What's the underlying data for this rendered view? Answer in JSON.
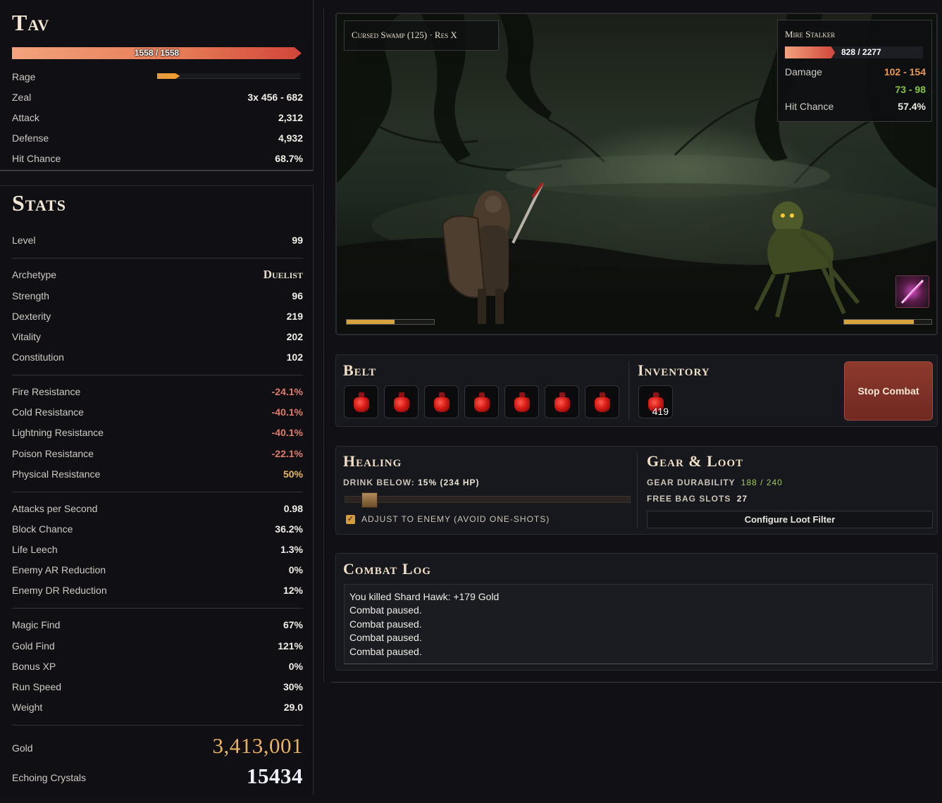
{
  "hero": {
    "name": "Tav",
    "hp_text": "1558 / 1558",
    "hp_fraction": 1.0,
    "rage_label": "Rage",
    "rage_fraction": 0.16,
    "rows": [
      {
        "label": "Zeal",
        "value": "3x 456 - 682"
      },
      {
        "label": "Attack",
        "value": "2,312"
      },
      {
        "label": "Defense",
        "value": "4,932"
      },
      {
        "label": "Hit Chance",
        "value": "68.7%"
      }
    ]
  },
  "stats": {
    "title": "Stats",
    "level": {
      "label": "Level",
      "value": "99"
    },
    "archetype": {
      "label": "Archetype",
      "value": "Duelist"
    },
    "attributes": [
      {
        "label": "Strength",
        "value": "96"
      },
      {
        "label": "Dexterity",
        "value": "219"
      },
      {
        "label": "Vitality",
        "value": "202"
      },
      {
        "label": "Constitution",
        "value": "102"
      }
    ],
    "resistances": [
      {
        "label": "Fire Resistance",
        "value": "-24.1%"
      },
      {
        "label": "Cold Resistance",
        "value": "-40.1%"
      },
      {
        "label": "Lightning Resistance",
        "value": "-40.1%"
      },
      {
        "label": "Poison Resistance",
        "value": "-22.1%"
      },
      {
        "label": "Physical Resistance",
        "value": "50%"
      }
    ],
    "combat": [
      {
        "label": "Attacks per Second",
        "value": "0.98"
      },
      {
        "label": "Block Chance",
        "value": "36.2%"
      },
      {
        "label": "Life Leech",
        "value": "1.3%"
      },
      {
        "label": "Enemy AR Reduction",
        "value": "0%"
      },
      {
        "label": "Enemy DR Reduction",
        "value": "12%"
      }
    ],
    "misc": [
      {
        "label": "Magic Find",
        "value": "67%"
      },
      {
        "label": "Gold Find",
        "value": "121%"
      },
      {
        "label": "Bonus XP",
        "value": "0%"
      },
      {
        "label": "Run Speed",
        "value": "30%"
      },
      {
        "label": "Weight",
        "value": "29.0"
      }
    ],
    "gold": {
      "label": "Gold",
      "value": "3,413,001"
    },
    "crystals": {
      "label": "Echoing Crystals",
      "value": "15434"
    }
  },
  "scene": {
    "zone": "Cursed Swamp (125) · Res X",
    "player_bar_fraction": 0.55,
    "enemy_bar_fraction": 0.8,
    "skill_icon": "arcane-slash-icon"
  },
  "enemy": {
    "name": "Mire Stalker",
    "hp_text": "828 / 2277",
    "hp_fraction": 0.364,
    "damage_label": "Damage",
    "damage_physical": "102 - 154",
    "damage_poison": "73 - 98",
    "hit_label": "Hit Chance",
    "hit_value": "57.4%"
  },
  "belt": {
    "title": "Belt",
    "slots": [
      "red-potion-icon",
      "red-potion-icon",
      "red-potion-icon",
      "red-potion-icon",
      "red-potion-icon",
      "red-potion-icon",
      "red-potion-icon"
    ]
  },
  "inventory": {
    "title": "Inventory",
    "item_icon": "red-potion-icon",
    "count": "419"
  },
  "stop_button": "Stop Combat",
  "healing": {
    "title": "Healing",
    "drink_label": "Drink below:",
    "drink_value": "15% (234 HP)",
    "threshold_fraction": 0.15,
    "adjust_label": "Adjust to enemy (avoid one-shots)",
    "adjust_checked": true
  },
  "gear": {
    "title": "Gear & Loot",
    "durability_label": "Gear durability",
    "durability_value": "188 / 240",
    "bag_label": "Free bag slots",
    "bag_value": "27",
    "loot_button": "Configure Loot Filter"
  },
  "log": {
    "title": "Combat Log",
    "lines": [
      "You killed Shard Hawk: +179 Gold",
      "Combat paused.",
      "Combat paused.",
      "Combat paused.",
      "Combat paused."
    ]
  },
  "colors": {
    "accent_gold": "#e7b360",
    "hp_red": "#d1453a",
    "negative": "#e07b6b",
    "stop_button": "#7e3125"
  }
}
